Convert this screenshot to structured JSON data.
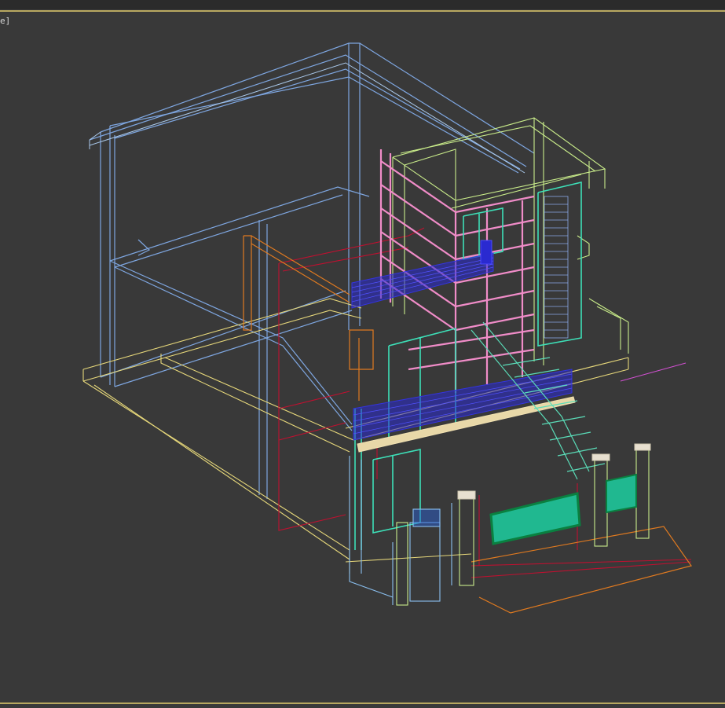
{
  "viewport": {
    "label": "e]",
    "render_mode": "wireframe",
    "accent_border_color": "#b8a860",
    "background_color": "#393939"
  },
  "scene": {
    "wire_colors": {
      "outer_frame": "#7ea6e0",
      "outer_frame_alt": "#a9c8ea",
      "yellow_floor": "#e6d77a",
      "tower_green": "#c9ec8a",
      "pink_railing": "#f08cc8",
      "cyan_window": "#3de0b8",
      "blue_balcony": "#2a2ad0",
      "red_lines": "#c01030",
      "orange_beam": "#e07a20",
      "stair_teal": "#5adcb8",
      "sign_fill": "#20b890",
      "magenta_line": "#d050d0"
    }
  }
}
